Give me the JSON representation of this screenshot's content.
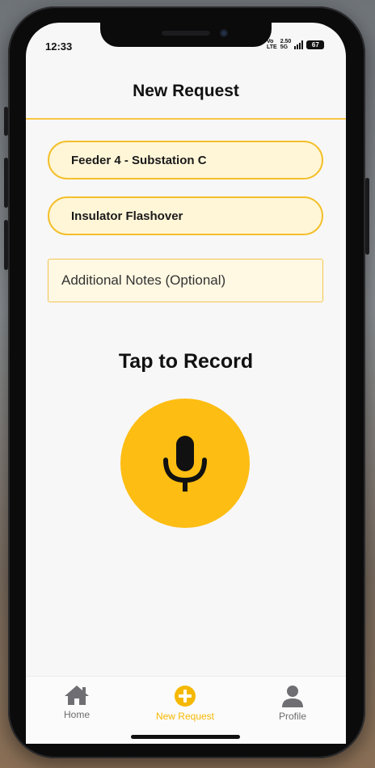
{
  "status_bar": {
    "time": "12:33",
    "network_top": "Vo",
    "network_bottom": "LTE",
    "data_top": "2.50",
    "data_bottom": "5G",
    "battery": "67"
  },
  "header": {
    "title": "New Request"
  },
  "form": {
    "feeder_value": "Feeder 4 - Substation C",
    "fault_value": "Insulator Flashover",
    "notes_placeholder": "Additional Notes (Optional)"
  },
  "recorder": {
    "label": "Tap to Record"
  },
  "tab_bar": {
    "items": [
      {
        "label": "Home",
        "icon": "home-icon"
      },
      {
        "label": "New Request",
        "icon": "plus-circle-icon"
      },
      {
        "label": "Profile",
        "icon": "person-icon"
      }
    ],
    "active": "New Request"
  },
  "colors": {
    "accent": "#fdbd12",
    "field_border": "#f4bf2a",
    "field_fill": "#fff6d8",
    "inactive_tab": "#6b6b6b"
  }
}
